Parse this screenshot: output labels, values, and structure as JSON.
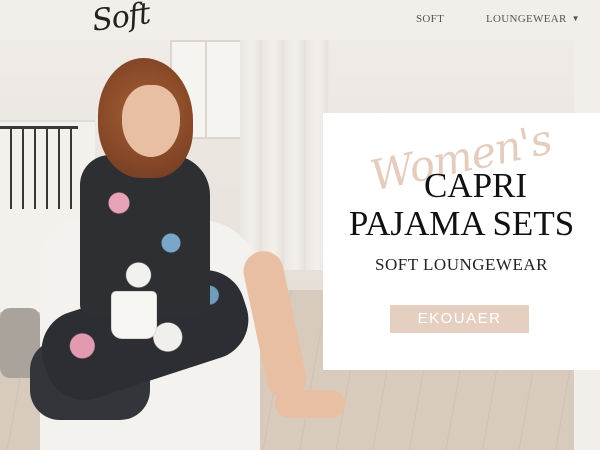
{
  "header": {
    "logo_text": "Soft",
    "nav": [
      {
        "label": "SOFT"
      },
      {
        "label": "LOUNGEWEAR"
      }
    ],
    "caret_icon": "chevron-down-icon"
  },
  "hero": {
    "script_text": "Women's",
    "title_line_1": "CAPRI",
    "title_line_2": "PAJAMA SETS",
    "subtitle": "SOFT LOUNGEWEAR",
    "cta_label": "EKOUAER",
    "colors": {
      "accent": "#e5cfc1",
      "script": "#e4cdbf",
      "background": "#f2eeea"
    }
  }
}
